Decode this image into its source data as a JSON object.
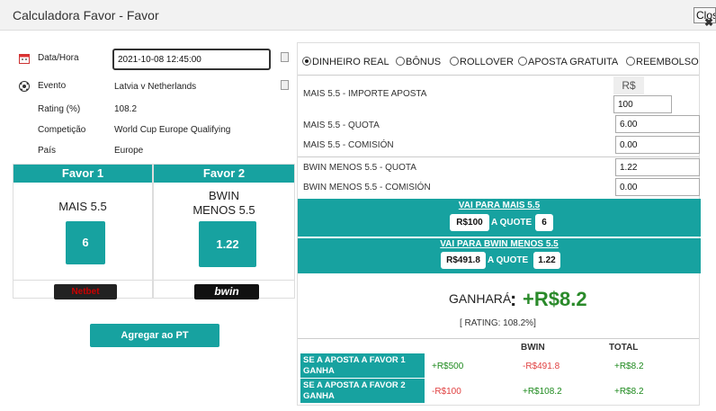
{
  "window": {
    "title": "Calculadora Favor - Favor",
    "close_label": "Close"
  },
  "info": {
    "date_label": "Data/Hora",
    "date_value": "2021-10-08 12:45:00",
    "event_label": "Evento",
    "event_value": "Latvia v Netherlands",
    "rating_label": "Rating (%)",
    "rating_value": "108.2",
    "competition_label": "Competição",
    "competition_value": "World Cup Europe Qualifying",
    "country_label": "País",
    "country_value": "Europe"
  },
  "favor1": {
    "header": "Favor 1",
    "name": "MAIS 5.5",
    "quote": "6",
    "bookmaker": "Netbet"
  },
  "favor2": {
    "header": "Favor 2",
    "name_line1": "BWIN",
    "name_line2": "MENOS 5.5",
    "quote": "1.22",
    "bookmaker": "bwin"
  },
  "add_button": "Agregar ao PT",
  "modes": [
    {
      "label": "DINHEIRO REAL",
      "selected": true
    },
    {
      "label": "BÔNUS",
      "selected": false
    },
    {
      "label": "ROLLOVER",
      "selected": false
    },
    {
      "label": "APOSTA GRATUITA",
      "selected": false
    },
    {
      "label": "REEMBOLSO",
      "selected": false
    }
  ],
  "calc": {
    "currency": "R$",
    "stake_label": "MAIS 5.5 - IMPORTE APOSTA",
    "stake_value": "100",
    "quote1_label": "MAIS 5.5 - QUOTA",
    "quote1_value": "6.00",
    "commission1_label": "MAIS 5.5 - COMISIÓN",
    "commission1_value": "0.00",
    "quote2_label": "BWIN MENOS 5.5  - QUOTA",
    "quote2_value": "1.22",
    "commission2_label": "BWIN MENOS 5.5 - COMISIÓN",
    "commission2_value": "0.00"
  },
  "bet1": {
    "link": "VAI PARA MAIS 5.5",
    "amount": "R$100",
    "at_quote": "A QUOTE",
    "quote": "6"
  },
  "bet2": {
    "link": "VAI PARA BWIN MENOS 5.5",
    "amount": "R$491.8",
    "at_quote": "A QUOTE",
    "quote": "1.22"
  },
  "result": {
    "label": "GANHARÁ",
    "colon": ":",
    "value": "+R$8.2",
    "rating": "[ RATING: 108.2%]"
  },
  "table": {
    "col_bwin": "BWIN",
    "col_total": "TOTAL",
    "row1_label": "SE A APOSTA A FAVOR 1 GANHA",
    "row1_a": "+R$500",
    "row1_b": "-R$491.8",
    "row1_total": "+R$8.2",
    "row2_label": "SE A APOSTA A FAVOR 2 GANHA",
    "row2_a": "-R$100",
    "row2_b": "+R$108.2",
    "row2_total": "+R$8.2"
  },
  "colors": {
    "accent": "#17a2a0",
    "positive": "#1e8a1e",
    "negative": "#e04040"
  }
}
